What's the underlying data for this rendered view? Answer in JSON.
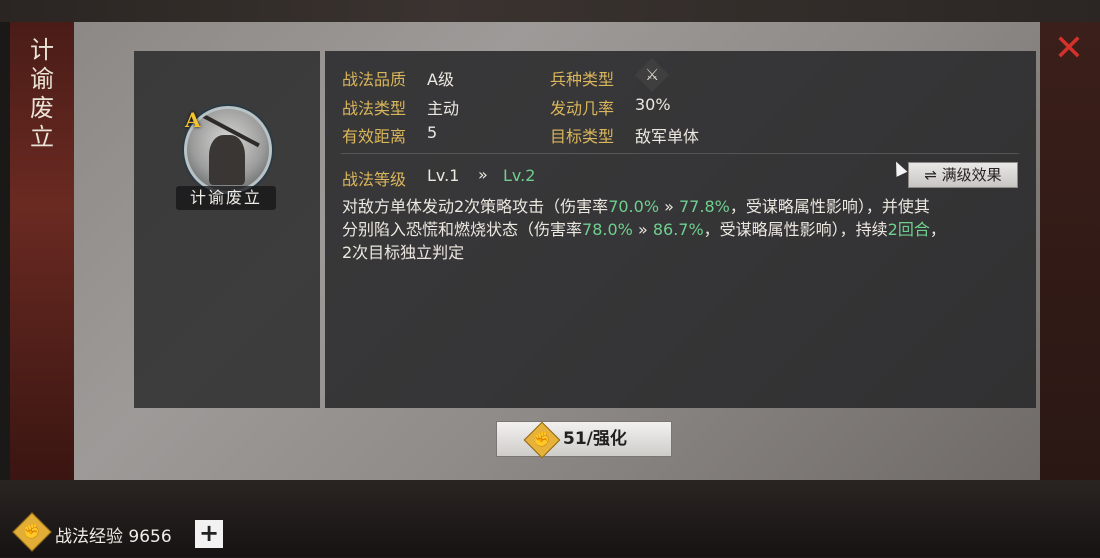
{
  "skill": {
    "side_title": "计谕废立",
    "portrait_name": "计谕废立",
    "grade_badge": "A",
    "quality_label": "战法品质",
    "quality_value": "A级",
    "troop_label": "兵种类型",
    "troop_icon": "crossed-weapons-icon",
    "type_label": "战法类型",
    "type_value": "主动",
    "rate_label": "发动几率",
    "rate_value": "30%",
    "range_label": "有效距离",
    "range_value": "5",
    "target_label": "目标类型",
    "target_value": "敌军单体",
    "level_label": "战法等级",
    "level_current": "Lv.1",
    "level_arrow": "»",
    "level_next": "Lv.2",
    "max_level_button": "满级效果",
    "description": {
      "p1": "对敌方单体发动2次策略攻击（伤害率",
      "dmg1_cur": "70.0%",
      "arrow": "»",
      "dmg1_next": "77.8%",
      "p2": "，受谋略属性影响），并使其",
      "p3": "分别陷入恐慌和燃烧状态（伤害率",
      "dmg2_cur": "78.0%",
      "dmg2_next": "86.7%",
      "p4": "，受谋略属性影响），持续",
      "duration": "2回合",
      "p5": "，",
      "p6": "2次目标独立判定"
    }
  },
  "enhance_button": {
    "label": "51/强化"
  },
  "footer": {
    "exp_text": "战法经验 9656",
    "plus_label": "+"
  },
  "colors": {
    "accent_green": "#6fcf8f",
    "label_gold": "#d9b65b",
    "close_red": "#d4312b"
  }
}
